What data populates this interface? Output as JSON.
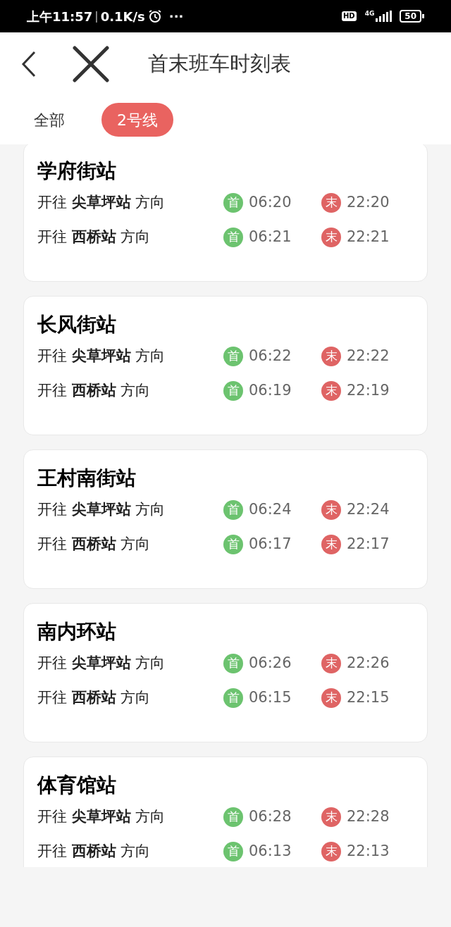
{
  "status_bar": {
    "time": "上午11:57",
    "separator": "|",
    "speed": "0.1K/s",
    "more": "···",
    "hd": "HD",
    "network": "4G",
    "battery": "50"
  },
  "header": {
    "title": "首末班车时刻表"
  },
  "tabs": [
    {
      "label": "全部",
      "selected": false
    },
    {
      "label": "2号线",
      "selected": true
    }
  ],
  "stations": [
    {
      "name": "学府街站",
      "directions": [
        {
          "text": "开往 **尖草坪站** 方向",
          "first_label": "首",
          "first": "06:20",
          "last_label": "末",
          "last": "22:20"
        },
        {
          "text": "开往 **西桥站** 方向",
          "first_label": "首",
          "first": "06:21",
          "last_label": "末",
          "last": "22:21"
        }
      ]
    },
    {
      "name": "长风街站",
      "directions": [
        {
          "text": "开往 **尖草坪站** 方向",
          "first_label": "首",
          "first": "06:22",
          "last_label": "末",
          "last": "22:22"
        },
        {
          "text": "开往 **西桥站** 方向",
          "first_label": "首",
          "first": "06:19",
          "last_label": "末",
          "last": "22:19"
        }
      ]
    },
    {
      "name": "王村南街站",
      "directions": [
        {
          "text": "开往 **尖草坪站** 方向",
          "first_label": "首",
          "first": "06:24",
          "last_label": "末",
          "last": "22:24"
        },
        {
          "text": "开往 **西桥站** 方向",
          "first_label": "首",
          "first": "06:17",
          "last_label": "末",
          "last": "22:17"
        }
      ]
    },
    {
      "name": "南内环站",
      "directions": [
        {
          "text": "开往 **尖草坪站** 方向",
          "first_label": "首",
          "first": "06:26",
          "last_label": "末",
          "last": "22:26"
        },
        {
          "text": "开往 **西桥站** 方向",
          "first_label": "首",
          "first": "06:15",
          "last_label": "末",
          "last": "22:15"
        }
      ]
    },
    {
      "name": "体育馆站",
      "directions": [
        {
          "text": "开往 **尖草坪站** 方向",
          "first_label": "首",
          "first": "06:28",
          "last_label": "末",
          "last": "22:28"
        },
        {
          "text": "开往 **西桥站** 方向",
          "first_label": "首",
          "first": "06:13",
          "last_label": "末",
          "last": "22:13"
        }
      ]
    }
  ]
}
